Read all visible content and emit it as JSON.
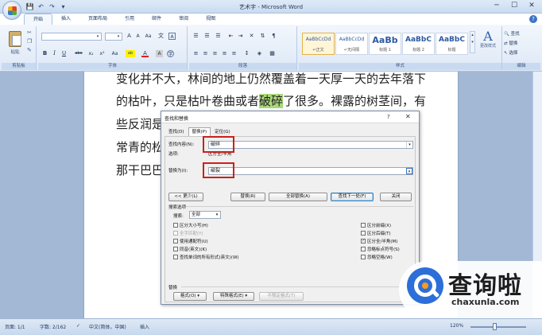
{
  "window": {
    "title": "艺术字 - Microsoft Word",
    "controls": [
      "─",
      "☐",
      "✕"
    ]
  },
  "qat": [
    "💾",
    "↶",
    "↷",
    "▾"
  ],
  "tabs": [
    "开始",
    "插入",
    "页面布局",
    "引用",
    "邮件",
    "审阅",
    "视图"
  ],
  "ribbon": {
    "clipboard": {
      "paste": "粘贴",
      "label": "剪贴板"
    },
    "font": {
      "label": "字体",
      "bold": "B",
      "italic": "I",
      "underline": "U",
      "strike": "abe",
      "sub": "x₂",
      "sup": "x²",
      "clear": "Aa",
      "grow": "A",
      "shrink": "A",
      "wen": "文",
      "color_a": "A",
      "highlight": "ab"
    },
    "paragraph": {
      "label": "段落"
    },
    "styles": {
      "label": "样式",
      "items": [
        {
          "sample": "AaBbCcDd",
          "name": "↵正文"
        },
        {
          "sample": "AaBbCcDd",
          "name": "↵无间隔"
        },
        {
          "sample": "AaBb",
          "name": "标题 1"
        },
        {
          "sample": "AaBbC",
          "name": "标题 2"
        },
        {
          "sample": "AaBbC",
          "name": "标题"
        }
      ],
      "change": "更改样式"
    },
    "editing": {
      "label": "编辑",
      "find": "查找",
      "replace": "替换",
      "select": "选择"
    }
  },
  "document": {
    "lines": [
      {
        "text": "变化并不大，林间的地上仍然覆盖着一天厚一天的去年落下"
      },
      {
        "before": "的枯叶，只是枯叶卷曲或者",
        "highlight": "破碎",
        "after": "了很多。裸露的树茎间，有"
      },
      {
        "text": "些反润是"
      },
      {
        "text": "常青的松"
      },
      {
        "text": "那干巴巴"
      }
    ]
  },
  "dialog": {
    "title": "查找和替换",
    "help": "?",
    "close": "✕",
    "tabs": [
      "查找(D)",
      "替换(P)",
      "定位(G)"
    ],
    "find_label": "查找内容(N):",
    "find_value": "破碎",
    "options_label": "选项:",
    "options_value": "区分全/半角",
    "replace_label": "替换为(I):",
    "replace_value": "破裂",
    "buttons": {
      "less": "<< 更少(L)",
      "replace": "替换(R)",
      "replace_all": "全部替换(A)",
      "find_next": "查找下一处(F)",
      "cancel": "关闭"
    },
    "search_options_label": "搜索选项",
    "search_label": "搜索:",
    "search_value": "全部",
    "checks_left": [
      {
        "label": "区分大小写(H)",
        "checked": false,
        "disabled": false
      },
      {
        "label": "全字匹配(Y)",
        "checked": false,
        "disabled": true
      },
      {
        "label": "使用通配符(U)",
        "checked": false,
        "disabled": false
      },
      {
        "label": "同音(英文)(K)",
        "checked": false,
        "disabled": false
      },
      {
        "label": "查找单词的所有形式(英文)(W)",
        "checked": false,
        "disabled": false
      }
    ],
    "checks_right": [
      {
        "label": "区分前缀(X)",
        "checked": false,
        "disabled": false
      },
      {
        "label": "区分后缀(T)",
        "checked": false,
        "disabled": false
      },
      {
        "label": "区分全/半角(M)",
        "checked": true,
        "disabled": false
      },
      {
        "label": "忽略标点符号(S)",
        "checked": false,
        "disabled": false
      },
      {
        "label": "忽略空格(W)",
        "checked": false,
        "disabled": false
      }
    ],
    "replace_section_label": "替换",
    "format_btn": "格式(O) ▾",
    "special_btn": "特殊格式(E) ▾",
    "no_format_btn": "不限定格式(T)"
  },
  "status": {
    "page": "页面: 1/1",
    "words": "字数: 2/162",
    "lang": "中文(简体，中国)",
    "insert": "插入",
    "zoom": "120%"
  },
  "watermark": {
    "cn": "查询啦",
    "url": "chaxunla.com"
  }
}
